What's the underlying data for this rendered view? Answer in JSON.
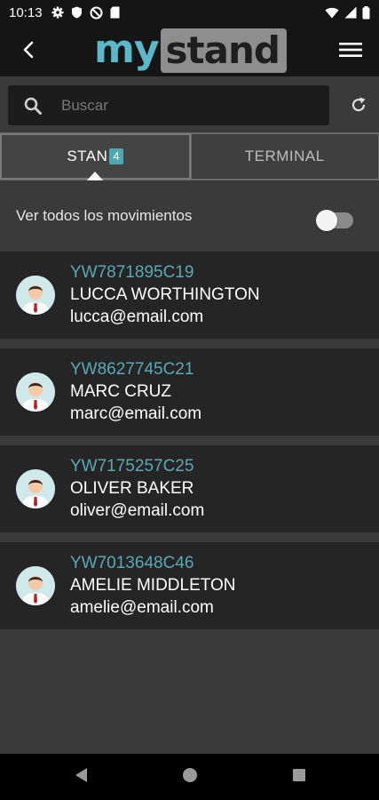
{
  "status_bar": {
    "time": "10:13",
    "icons_left": [
      "gear-icon",
      "shield-icon",
      "no-data-icon",
      "sim-card-icon"
    ],
    "icons_right": [
      "wifi-icon",
      "signal-icon",
      "battery-icon"
    ]
  },
  "header": {
    "logo_part1": "my",
    "logo_part2": "stand",
    "back_icon": "chevron-left-icon",
    "menu_icon": "hamburger-menu-icon"
  },
  "search": {
    "placeholder": "Buscar",
    "value": ""
  },
  "tabs": [
    {
      "label": "STAN",
      "badge": "4",
      "active": true
    },
    {
      "label": "TERMINAL",
      "active": false
    }
  ],
  "toggle": {
    "label": "Ver todos los movimientos",
    "on": false
  },
  "contacts": [
    {
      "code": "YW7871895C19",
      "name": "LUCCA WORTHINGTON",
      "email": "lucca@email.com"
    },
    {
      "code": "YW8627745C21",
      "name": "MARC CRUZ",
      "email": "marc@email.com"
    },
    {
      "code": "YW7175257C25",
      "name": "OLIVER BAKER",
      "email": "oliver@email.com"
    },
    {
      "code": "YW7013648C46",
      "name": "AMELIE MIDDLETON",
      "email": "amelie@email.com"
    }
  ],
  "colors": {
    "accent": "#4fa6b5",
    "code_text": "#5aa9b7",
    "background": "#3a3a3a",
    "card": "#252525",
    "header": "#151515"
  }
}
